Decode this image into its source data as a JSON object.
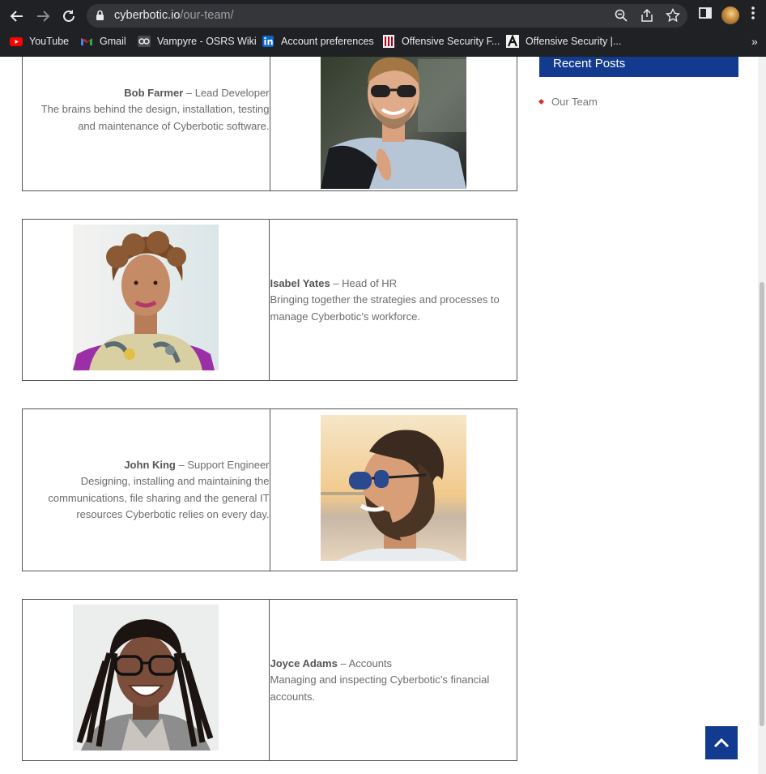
{
  "browser": {
    "url_host": "cyberbotic.io",
    "url_path": "/our-team/",
    "bookmarks": [
      {
        "label": "YouTube",
        "icon": "youtube-icon"
      },
      {
        "label": "Gmail",
        "icon": "gmail-icon"
      },
      {
        "label": "Vampyre - OSRS Wiki",
        "icon": "osrs-wiki-icon"
      },
      {
        "label": "Account preferences",
        "icon": "linkedin-icon"
      },
      {
        "label": "Offensive Security F...",
        "icon": "offsec-icon"
      },
      {
        "label": "Offensive Security |...",
        "icon": "offsec-icon"
      }
    ],
    "overflow_label": "»"
  },
  "team": [
    {
      "name": "Bob Farmer",
      "role": " – Lead Developer",
      "bio": "The brains behind the design, installation, testing and maintenance of Cyberbotic software.",
      "text_side": "left",
      "photo": "bob-farmer-photo"
    },
    {
      "name": "Isabel Yates",
      "role": " – Head of HR",
      "bio": "Bringing together the strategies and processes to manage Cyberbotic’s workforce.",
      "text_side": "right",
      "photo": "isabel-yates-photo"
    },
    {
      "name": "John King",
      "role": " – Support Engineer",
      "bio": "Designing, installing and maintaining the communications, file sharing and the general IT resources Cyberbotic relies on every day.",
      "text_side": "left",
      "photo": "john-king-photo"
    },
    {
      "name": "Joyce Adams",
      "role": " – Accounts",
      "bio": "Managing and inspecting Cyberbotic’s financial accounts.",
      "text_side": "right",
      "photo": "joyce-adams-photo"
    }
  ],
  "sidebar": {
    "header": "Recent Posts",
    "items": [
      "Our Team"
    ]
  },
  "colors": {
    "brand_blue": "#123a8e",
    "bullet_red": "#d9312a",
    "chrome_dark": "#202124"
  }
}
